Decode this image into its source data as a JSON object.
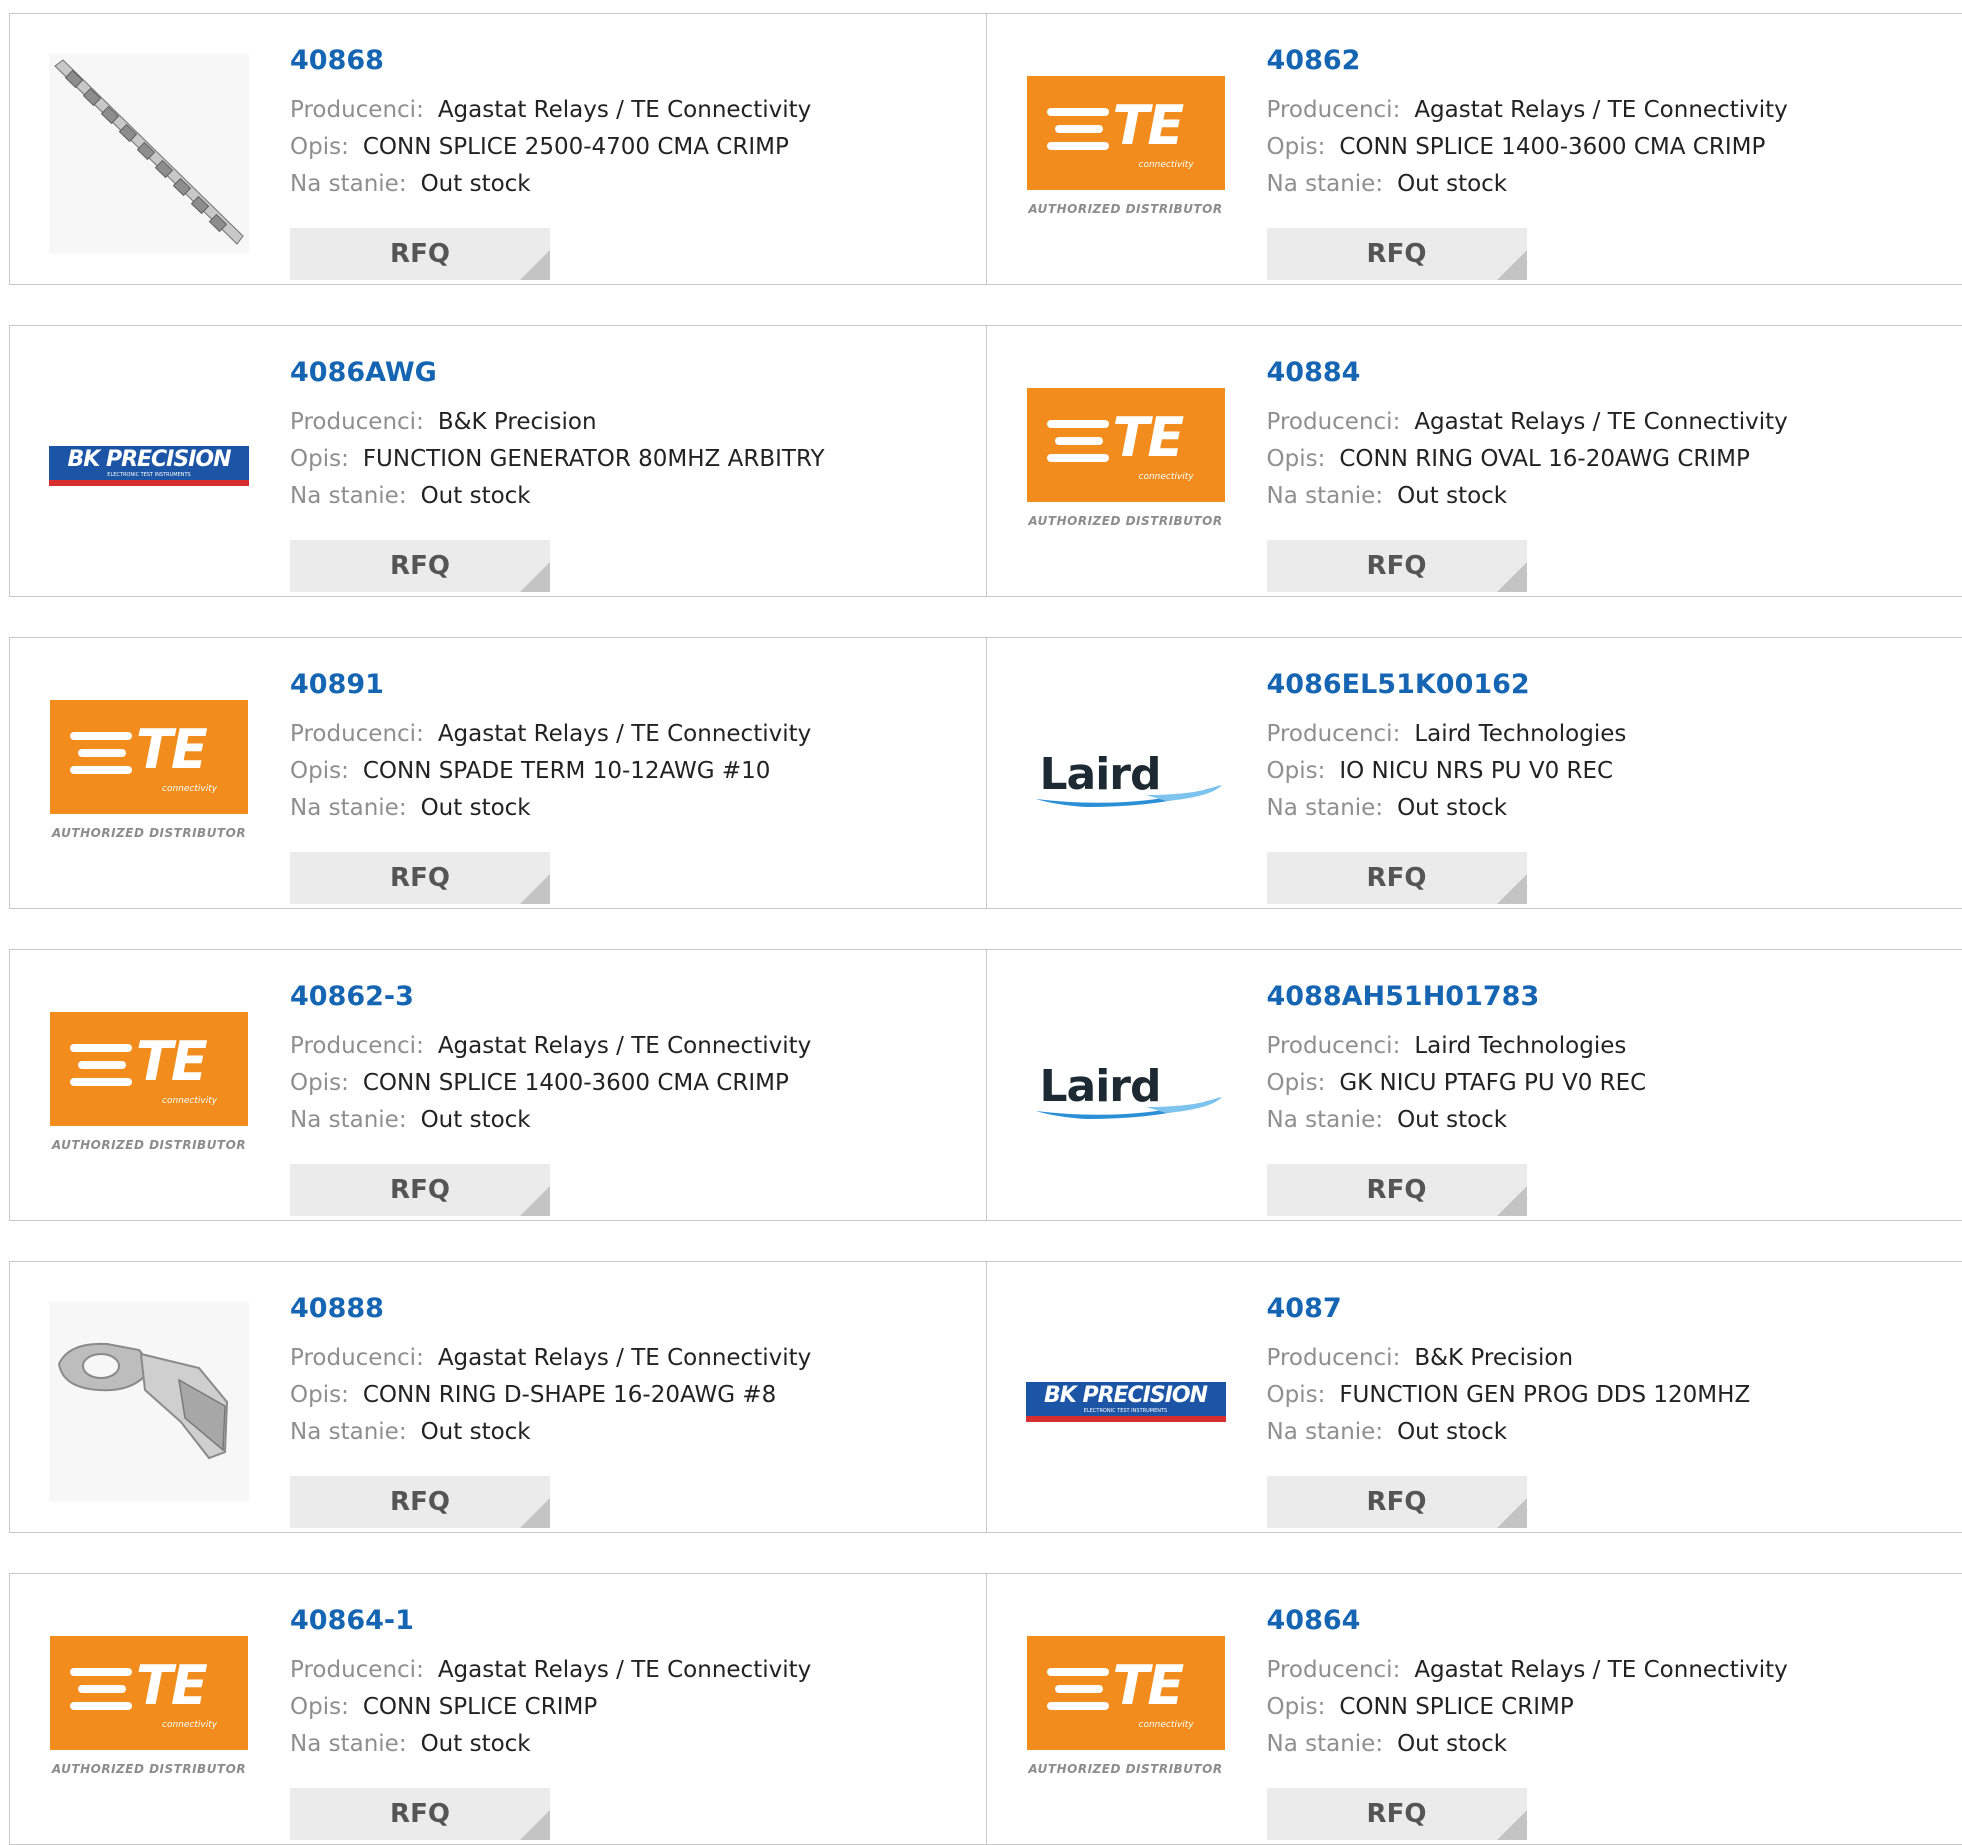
{
  "labels": {
    "manufacturer": "Producenci:",
    "description": "Opis:",
    "stock": "Na stanie:",
    "rfq": "RFQ"
  },
  "logo_text": {
    "te": "TE",
    "te_sub": "connectivity",
    "te_dist": "AUTHORIZED DISTRIBUTOR",
    "bk": "BK PRECISION",
    "bk_sub": "ELECTRONIC TEST INSTRUMENTS",
    "laird": "Laird"
  },
  "colors": {
    "link": "#1565b3",
    "te_orange": "#f28c1d",
    "bk_blue": "#1c55a6",
    "bk_red": "#d62e2e",
    "laird_blue": "#2a8fd6"
  },
  "products": [
    {
      "part": "40868",
      "manufacturer": "Agastat Relays / TE Connectivity",
      "description": "CONN SPLICE 2500-4700 CMA CRIMP",
      "stock": "Out stock",
      "image": "splice-strip-photo"
    },
    {
      "part": "40862",
      "manufacturer": "Agastat Relays / TE Connectivity",
      "description": "CONN SPLICE 1400-3600 CMA CRIMP",
      "stock": "Out stock",
      "image": "te-logo"
    },
    {
      "part": "4086AWG",
      "manufacturer": "B&K Precision",
      "description": "FUNCTION GENERATOR 80MHZ ARBITRY",
      "stock": "Out stock",
      "image": "bk-logo"
    },
    {
      "part": "40884",
      "manufacturer": "Agastat Relays / TE Connectivity",
      "description": "CONN RING OVAL 16-20AWG CRIMP",
      "stock": "Out stock",
      "image": "te-logo"
    },
    {
      "part": "40891",
      "manufacturer": "Agastat Relays / TE Connectivity",
      "description": "CONN SPADE TERM 10-12AWG #10",
      "stock": "Out stock",
      "image": "te-logo"
    },
    {
      "part": "4086EL51K00162",
      "manufacturer": "Laird Technologies",
      "description": "IO NICU NRS PU V0 REC",
      "stock": "Out stock",
      "image": "laird-logo"
    },
    {
      "part": "40862-3",
      "manufacturer": "Agastat Relays / TE Connectivity",
      "description": "CONN SPLICE 1400-3600 CMA CRIMP",
      "stock": "Out stock",
      "image": "te-logo"
    },
    {
      "part": "4088AH51H01783",
      "manufacturer": "Laird Technologies",
      "description": "GK NICU PTAFG PU V0 REC",
      "stock": "Out stock",
      "image": "laird-logo"
    },
    {
      "part": "40888",
      "manufacturer": "Agastat Relays / TE Connectivity",
      "description": "CONN RING D-SHAPE 16-20AWG #8",
      "stock": "Out stock",
      "image": "ring-terminal-photo"
    },
    {
      "part": "4087",
      "manufacturer": "B&K Precision",
      "description": "FUNCTION GEN PROG DDS 120MHZ",
      "stock": "Out stock",
      "image": "bk-logo"
    },
    {
      "part": "40864-1",
      "manufacturer": "Agastat Relays / TE Connectivity",
      "description": "CONN SPLICE CRIMP",
      "stock": "Out stock",
      "image": "te-logo"
    },
    {
      "part": "40864",
      "manufacturer": "Agastat Relays / TE Connectivity",
      "description": "CONN SPLICE CRIMP",
      "stock": "Out stock",
      "image": "te-logo"
    }
  ]
}
